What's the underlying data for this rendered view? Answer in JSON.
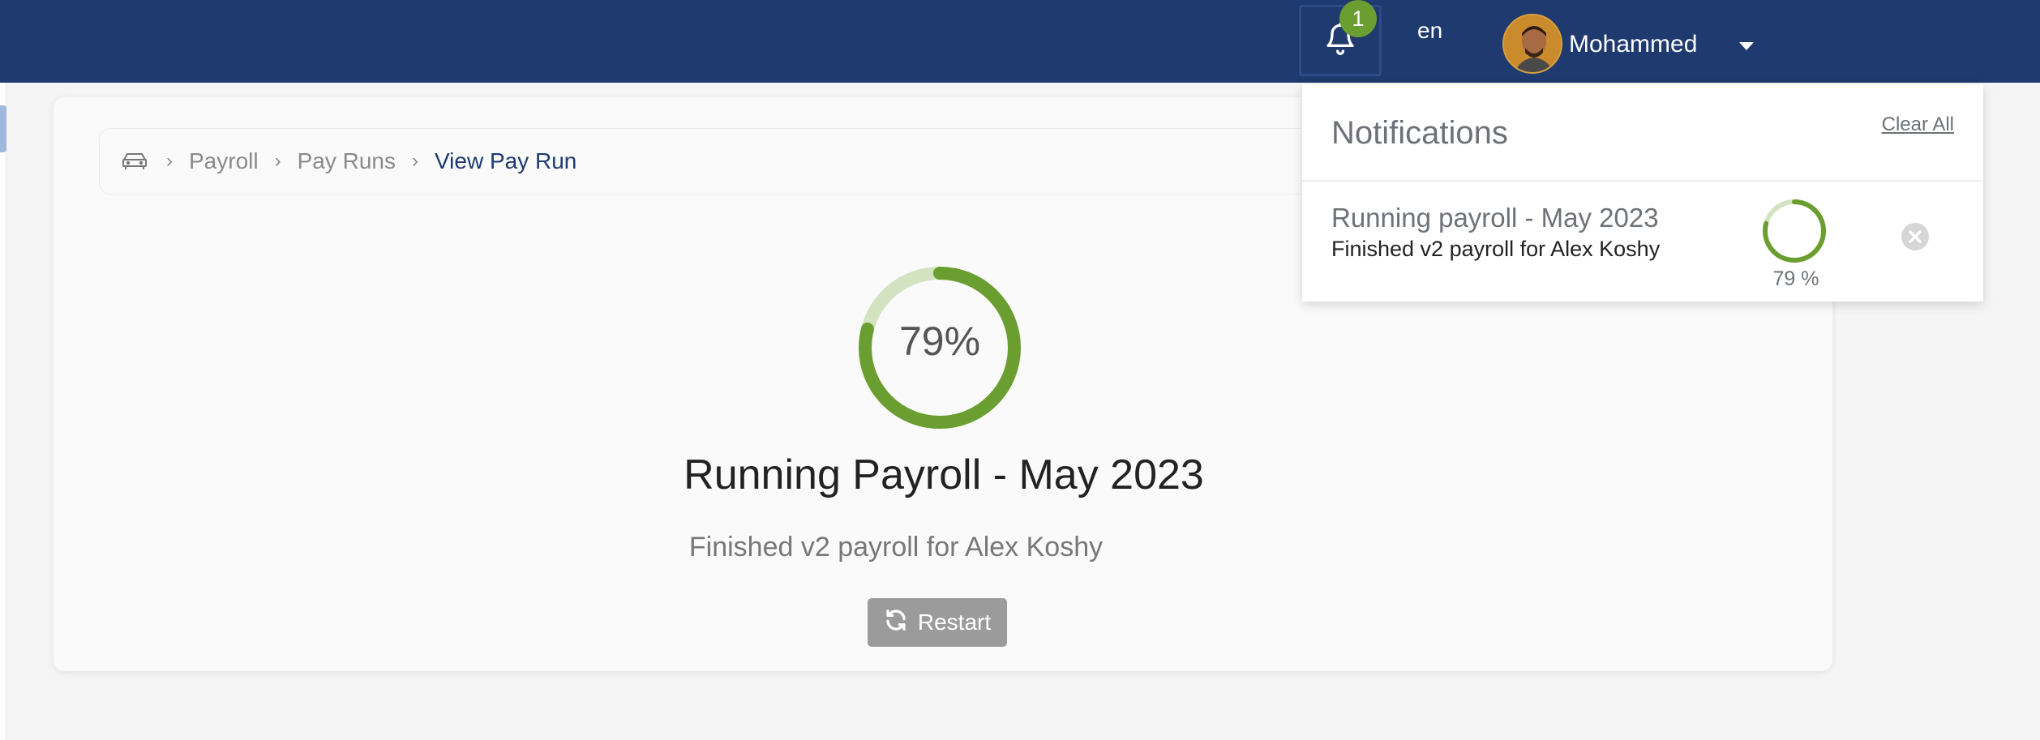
{
  "header": {
    "notification_count": "1",
    "language": "en",
    "user_name": "Mohammed"
  },
  "breadcrumb": {
    "items": [
      "Payroll",
      "Pay Runs",
      "View Pay Run"
    ]
  },
  "progress": {
    "percent_label": "79%",
    "value": 0.79,
    "title": "Running Payroll - May 2023",
    "subtitle": "Finished v2 payroll for Alex Koshy",
    "restart_label": "Restart"
  },
  "notifications": {
    "title": "Notifications",
    "clear_all_label": "Clear All",
    "items": [
      {
        "title": "Running payroll - May 2023",
        "subtitle": "Finished v2 payroll for Alex Koshy",
        "percent_label": "79 %"
      }
    ]
  },
  "colors": {
    "topbar": "#1e3a6e",
    "progress_green": "#6b9e30",
    "progress_track": "#d3e3c2",
    "badge": "#6b9e30"
  },
  "icons": [
    "bell-icon",
    "home-icon",
    "chevron-right-icon",
    "caret-down-icon",
    "refresh-icon",
    "close-circle-icon"
  ]
}
